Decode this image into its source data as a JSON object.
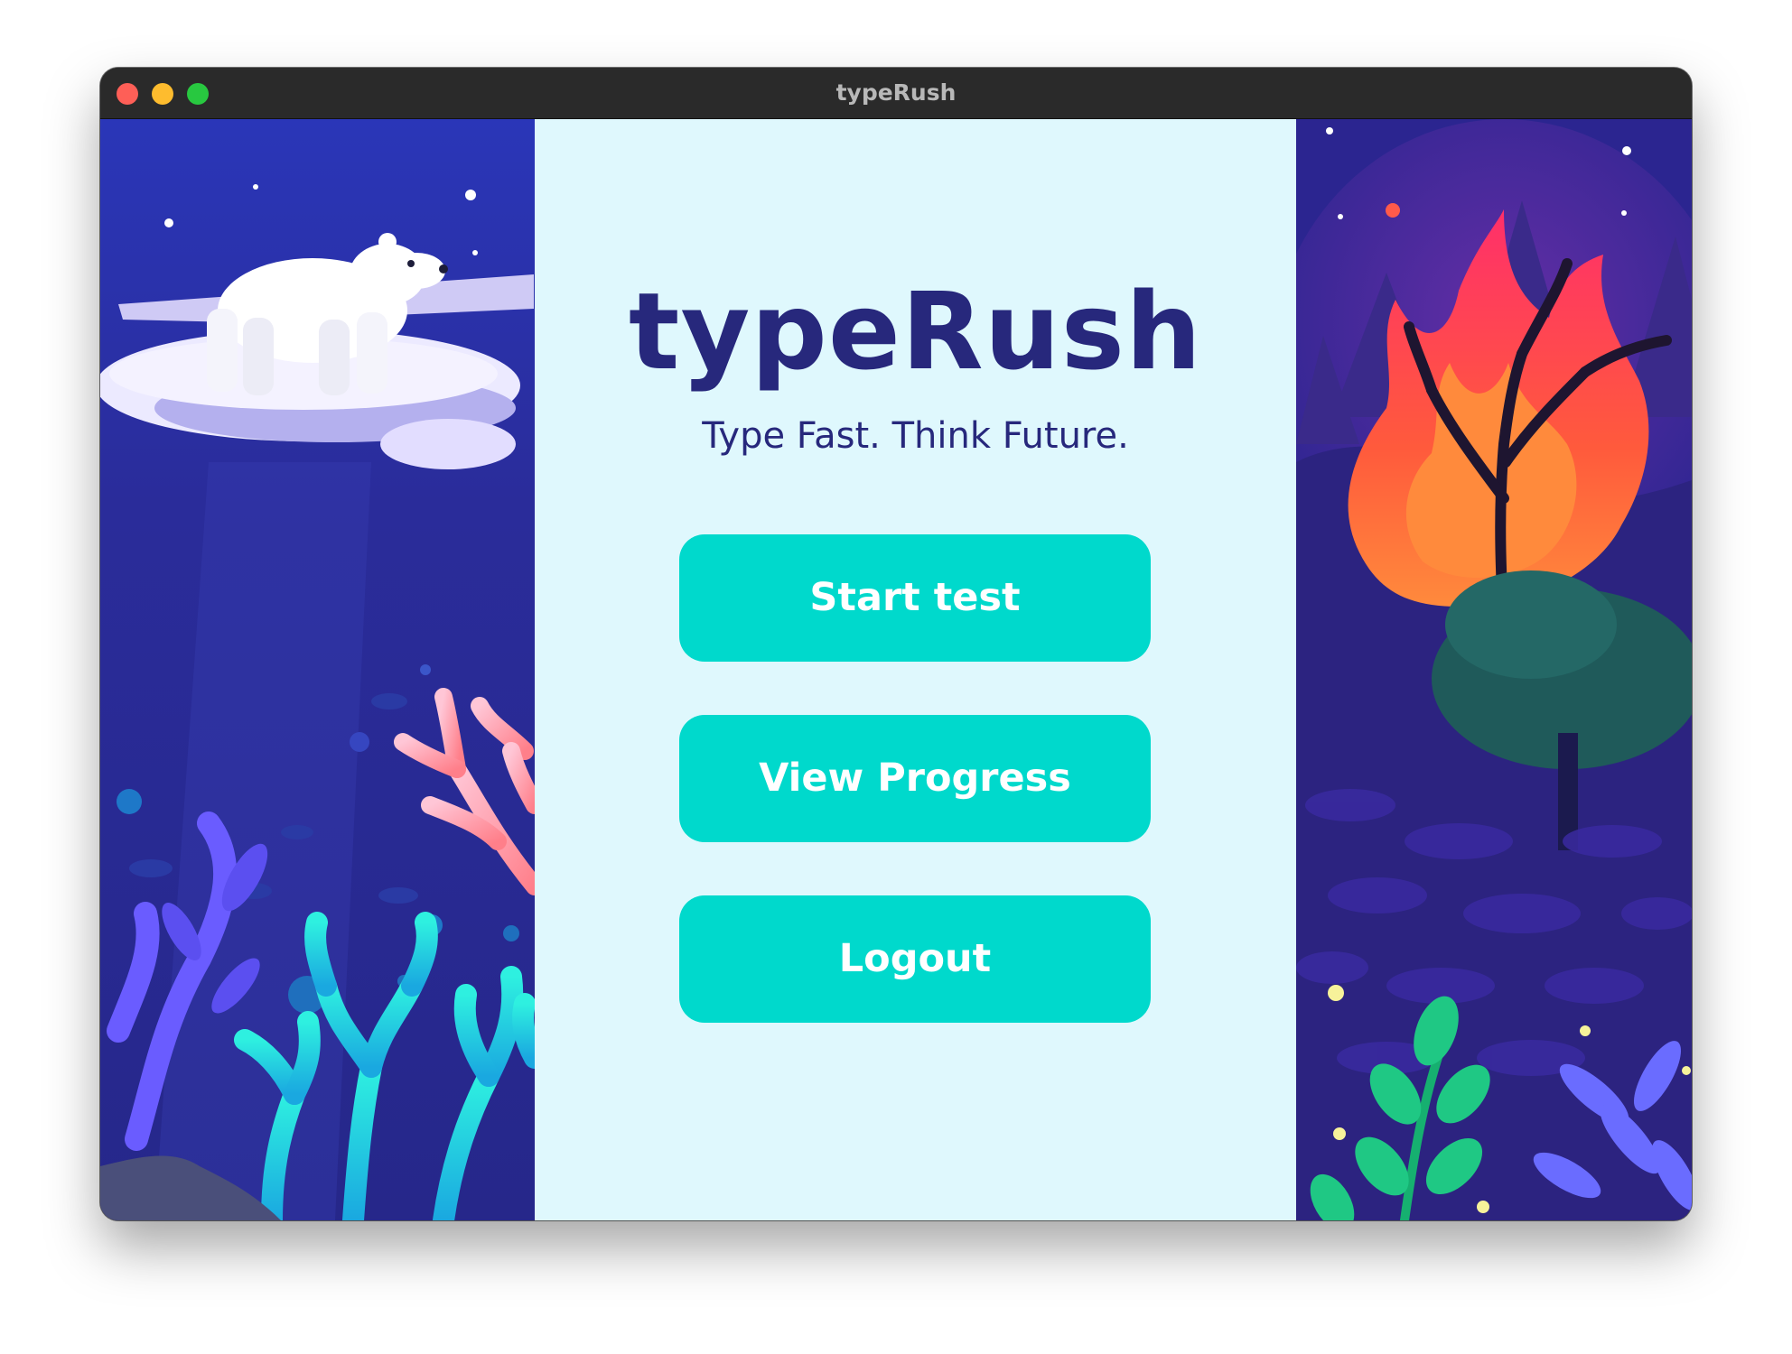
{
  "window": {
    "title": "typeRush"
  },
  "app": {
    "name": "typeRush",
    "tagline": "Type Fast. Think Future."
  },
  "menu": {
    "start_label": "Start test",
    "progress_label": "View Progress",
    "logout_label": "Logout"
  },
  "colors": {
    "accent": "#00d9cc",
    "title_text": "#27287c",
    "center_background": "#dff8fd",
    "ocean": "#2b2a8f",
    "fire": "#ff5a3c"
  },
  "illustrations": {
    "left": "ocean-polar-bear-coral-illustration",
    "right": "forest-fire-illustration"
  }
}
